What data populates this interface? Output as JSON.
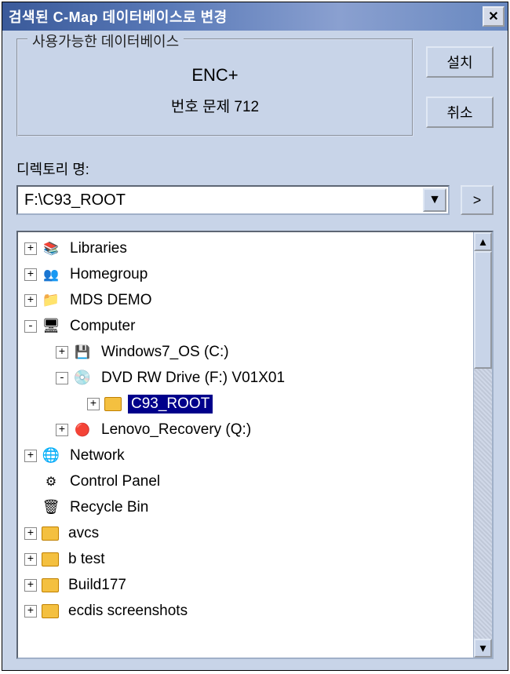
{
  "titlebar": {
    "title": "검색된 C-Map 데이터베이스로 변경"
  },
  "groupbox": {
    "legend": "사용가능한 데이터베이스",
    "line1": "ENC+",
    "line2": "번호 문제 712"
  },
  "buttons": {
    "install": "설치",
    "cancel": "취소",
    "go": ">"
  },
  "directory": {
    "label": "디렉토리 명:",
    "path": "F:\\C93_ROOT"
  },
  "tree": {
    "items": [
      {
        "indent": 0,
        "expander": "+",
        "iconClass": "lib-icon",
        "label": "Libraries"
      },
      {
        "indent": 0,
        "expander": "+",
        "iconClass": "people-icon",
        "label": "Homegroup"
      },
      {
        "indent": 0,
        "expander": "+",
        "iconClass": "mds-icon",
        "label": "MDS DEMO"
      },
      {
        "indent": 0,
        "expander": "-",
        "iconClass": "monitor-icon",
        "label": "Computer"
      },
      {
        "indent": 1,
        "expander": "+",
        "iconClass": "drive-icon",
        "label": "Windows7_OS (C:)"
      },
      {
        "indent": 1,
        "expander": "-",
        "iconClass": "dvd-icon",
        "label": "DVD RW Drive (F:) V01X01"
      },
      {
        "indent": 2,
        "expander": "+",
        "iconClass": "folder-icon",
        "label": "C93_ROOT",
        "selected": true
      },
      {
        "indent": 1,
        "expander": "+",
        "iconClass": "recovery-icon",
        "label": "Lenovo_Recovery (Q:)"
      },
      {
        "indent": 0,
        "expander": "+",
        "iconClass": "globe-icon",
        "label": "Network"
      },
      {
        "indent": 0,
        "expander": "",
        "iconClass": "panel-icon",
        "label": "Control Panel"
      },
      {
        "indent": 0,
        "expander": "",
        "iconClass": "recycle-icon",
        "label": "Recycle Bin"
      },
      {
        "indent": 0,
        "expander": "+",
        "iconClass": "folder-icon",
        "label": "avcs"
      },
      {
        "indent": 0,
        "expander": "+",
        "iconClass": "folder-icon",
        "label": "b test"
      },
      {
        "indent": 0,
        "expander": "+",
        "iconClass": "folder-icon",
        "label": "Build177"
      },
      {
        "indent": 0,
        "expander": "+",
        "iconClass": "folder-icon",
        "label": "ecdis screenshots"
      }
    ]
  }
}
